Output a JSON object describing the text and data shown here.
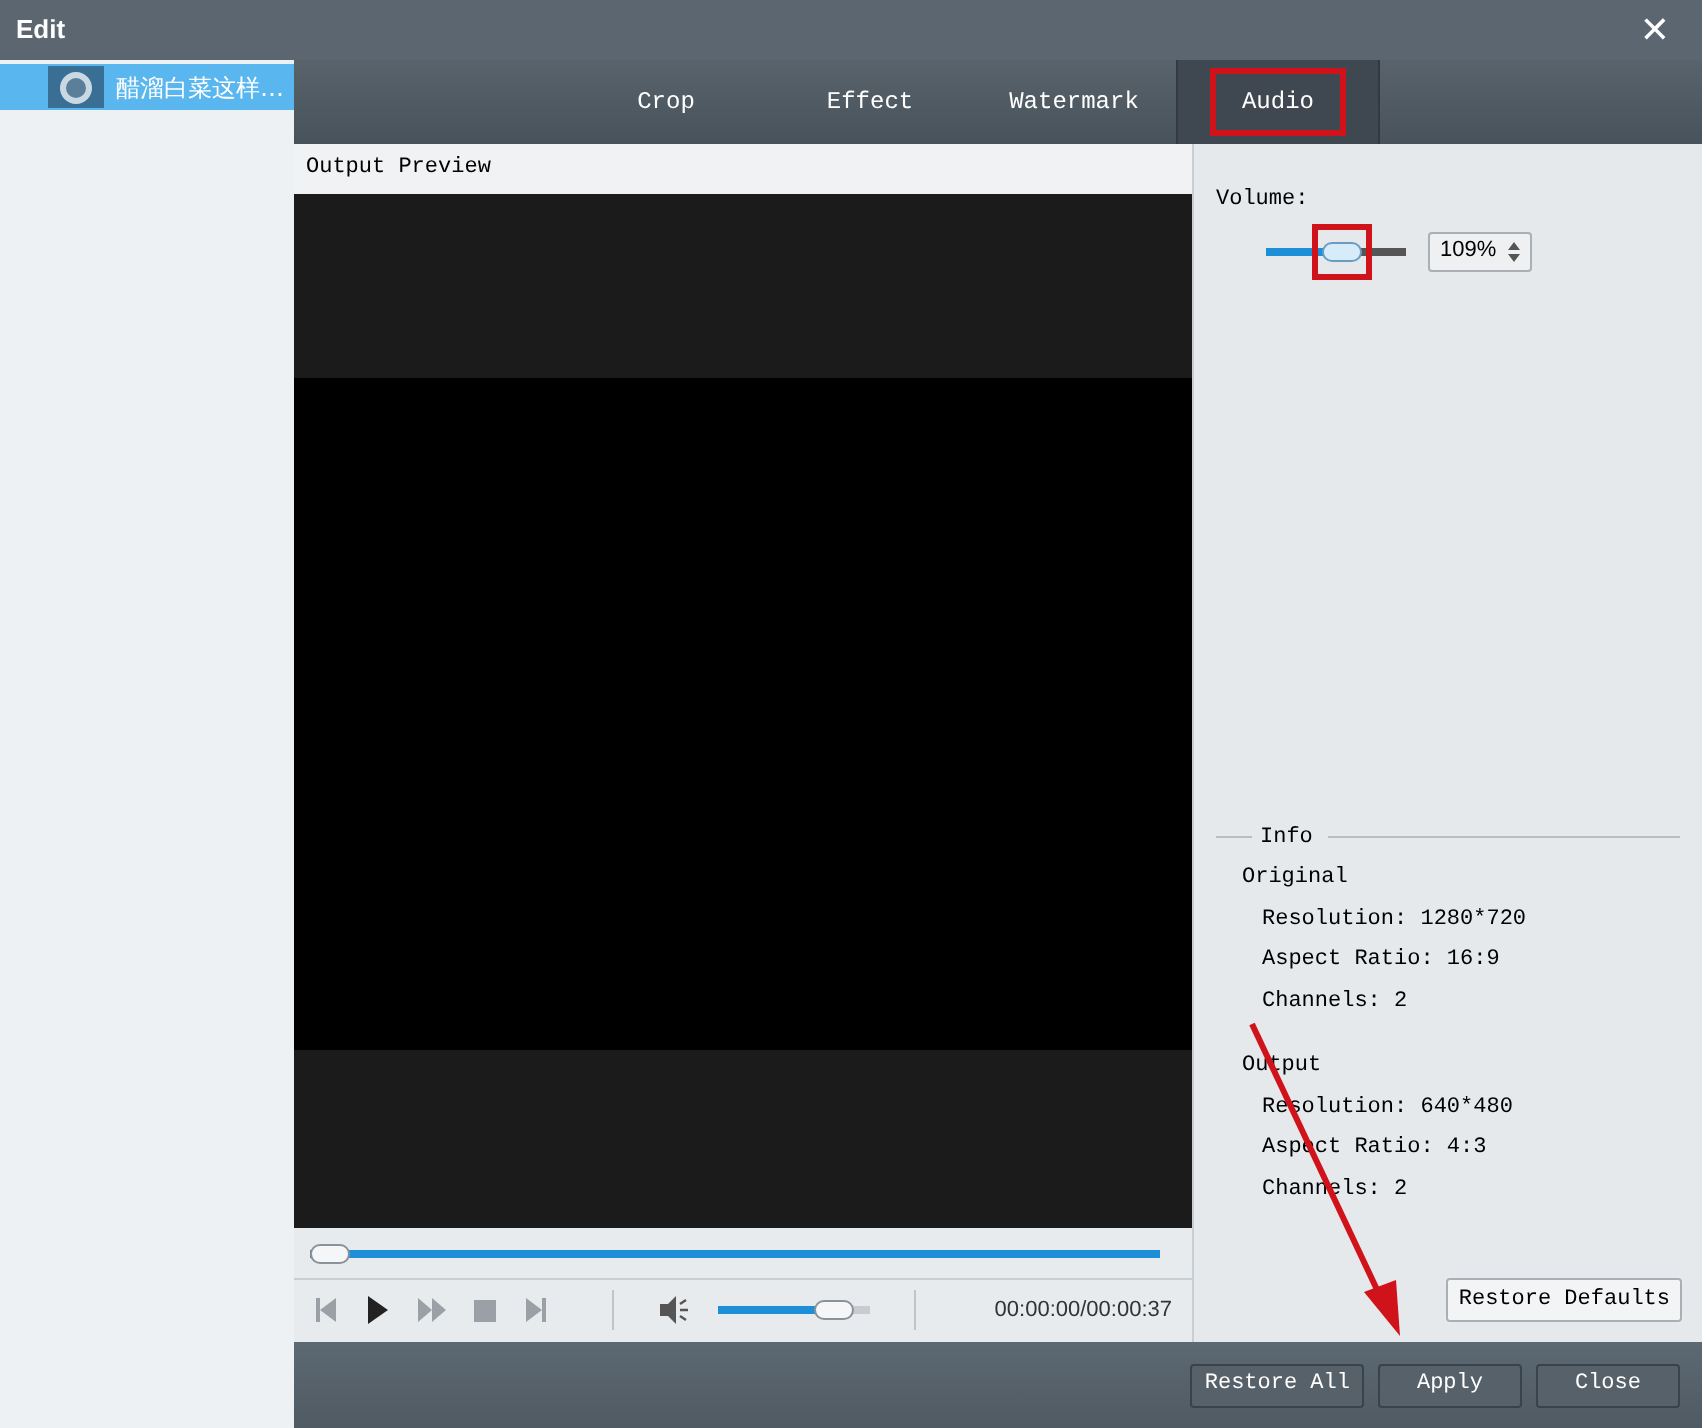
{
  "window": {
    "title": "Edit",
    "close": "✕"
  },
  "sidebar": {
    "items": [
      {
        "label": "醋溜白菜这样…",
        "selected": true
      }
    ]
  },
  "tabs": [
    {
      "label": "Crop",
      "selected": false,
      "highlighted": false
    },
    {
      "label": "Effect",
      "selected": false,
      "highlighted": false
    },
    {
      "label": "Watermark",
      "selected": false,
      "highlighted": false
    },
    {
      "label": "Audio",
      "selected": true,
      "highlighted": true
    }
  ],
  "preview": {
    "title": "Output Preview",
    "progress": {
      "level": 0
    },
    "volume": {
      "level": 0.85
    },
    "time": "00:00:00/00:00:37"
  },
  "audio": {
    "volume_label": "Volume:",
    "volume": {
      "level": 0.55,
      "highlighted": true
    },
    "volume_value": "109%"
  },
  "info": {
    "title": "Info",
    "groups": [
      {
        "title": "Original",
        "lines": [
          "Resolution: 1280*720",
          "Aspect Ratio: 16:9",
          "Channels: 2"
        ]
      },
      {
        "title": "Output",
        "lines": [
          "Resolution: 640*480",
          "Aspect Ratio: 4:3",
          "Channels: 2"
        ]
      }
    ]
  },
  "restore_defaults": "Restore Defaults",
  "buttons": [
    {
      "label": "Restore All"
    },
    {
      "label": "Apply"
    },
    {
      "label": "Close"
    }
  ],
  "annotation_arrow": true
}
